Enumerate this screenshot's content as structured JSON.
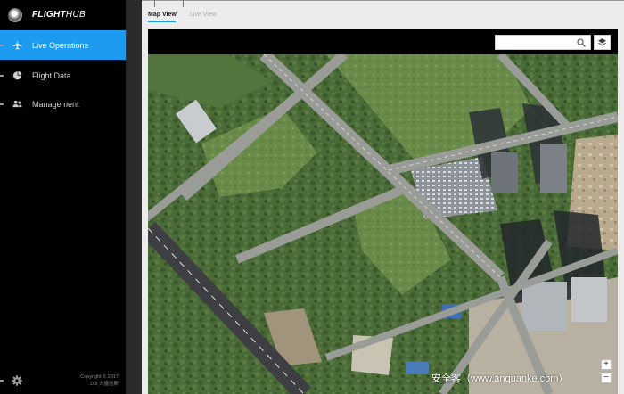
{
  "brand": {
    "name_bold": "FLIGHT",
    "name_light": "HUB"
  },
  "sidebar": {
    "items": [
      {
        "label": "Live Operations",
        "icon": "airplane-icon",
        "active": true
      },
      {
        "label": "Flight Data",
        "icon": "pie-chart-icon",
        "active": false
      },
      {
        "label": "Management",
        "icon": "users-icon",
        "active": false
      }
    ],
    "settings_icon": "gear-icon",
    "copyright_line1": "Copyright © 2017",
    "copyright_line2": "DJI 大疆创新"
  },
  "tabs": [
    {
      "label": "Map View",
      "active": true
    },
    {
      "label": "Live View",
      "active": false
    }
  ],
  "map": {
    "search": {
      "value": "",
      "placeholder": ""
    },
    "layers_icon": "layers-icon",
    "zoom_in": "+",
    "zoom_out": "−",
    "watermark": "安全客（www.anquanke.com）"
  },
  "colors": {
    "accent": "#1d9bf0",
    "sidebar_bg": "#000000"
  }
}
